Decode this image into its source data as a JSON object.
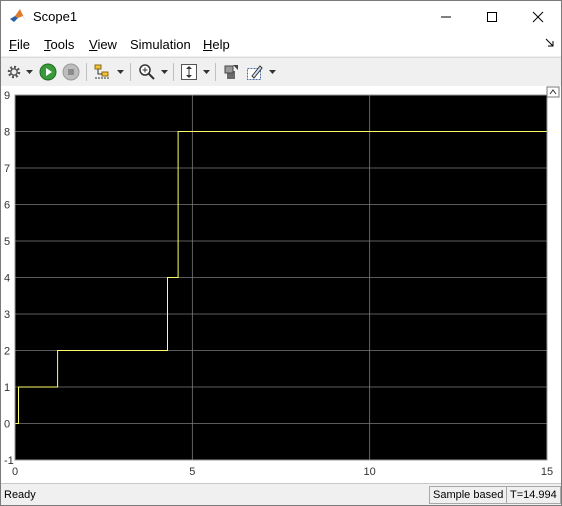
{
  "window": {
    "title": "Scope1"
  },
  "menu": [
    {
      "mnemonic": "F",
      "rest": "ile"
    },
    {
      "mnemonic": "T",
      "rest": "ools"
    },
    {
      "mnemonic": "V",
      "rest": "iew"
    },
    {
      "mnemonic": "S",
      "rest": "imulation",
      "pre": ""
    },
    {
      "mnemonic": "H",
      "rest": "elp"
    }
  ],
  "menu_labels": [
    "File",
    "Tools",
    "View",
    "Simulation",
    "Help"
  ],
  "toolbar": {
    "buttons": [
      "settings-gear",
      "run",
      "stop",
      "signal-selector",
      "zoom-in",
      "autoscale-axes",
      "write-data",
      "highlight-block"
    ]
  },
  "status": {
    "left": "Ready",
    "mode": "Sample based",
    "time": "T=14.994"
  },
  "chart_data": {
    "type": "line",
    "title": "",
    "xlabel": "",
    "ylabel": "",
    "xlim": [
      0,
      15
    ],
    "ylim": [
      -1,
      9
    ],
    "xticks": [
      0,
      5,
      10,
      15
    ],
    "yticks": [
      -1,
      0,
      1,
      2,
      3,
      4,
      5,
      6,
      7,
      8,
      9
    ],
    "grid": true,
    "background": "#000000",
    "series": [
      {
        "color": "#ffff66",
        "step": true,
        "x": [
          0,
          0.1,
          0.1,
          1.2,
          1.2,
          4.3,
          4.3,
          4.6,
          4.6,
          15
        ],
        "y": [
          0,
          0,
          1,
          1,
          2,
          2,
          4,
          4,
          8,
          8
        ]
      }
    ]
  },
  "colors": {
    "plot_bg": "#000000",
    "grid": "#7a7a7a",
    "trace": "#ffff66"
  }
}
